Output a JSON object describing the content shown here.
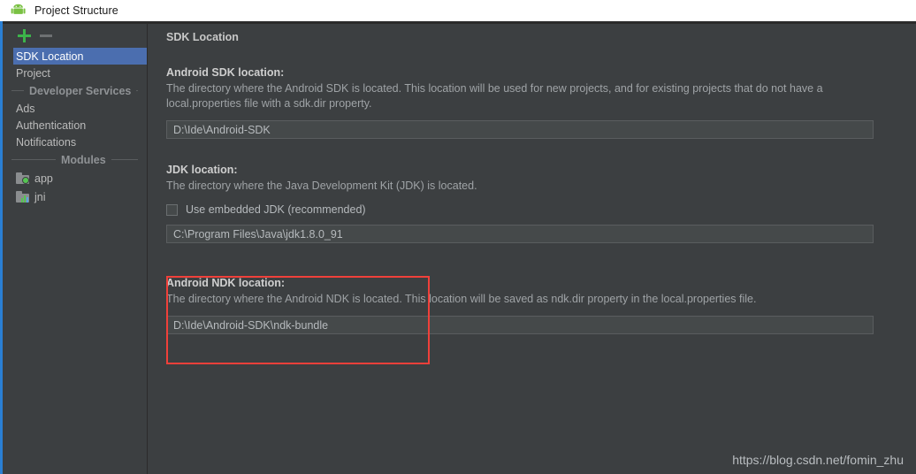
{
  "window": {
    "title": "Project Structure",
    "icon": "android-robot-icon"
  },
  "sidebar": {
    "toolbar": {
      "add_label": "+",
      "add_icon": "plus-icon",
      "remove_label": "−",
      "remove_icon": "minus-icon"
    },
    "items": [
      {
        "label": "SDK Location",
        "selected": true
      },
      {
        "label": "Project",
        "selected": false
      }
    ],
    "separators": {
      "developer_services": "Developer Services",
      "modules": "Modules"
    },
    "services": [
      {
        "label": "Ads"
      },
      {
        "label": "Authentication"
      },
      {
        "label": "Notifications"
      }
    ],
    "modules": [
      {
        "label": "app",
        "icon": "folder-green-dot-icon"
      },
      {
        "label": "jni",
        "icon": "folder-library-icon"
      }
    ]
  },
  "main": {
    "panel_title": "SDK Location",
    "sections": [
      {
        "heading": "Android SDK location:",
        "description": "The directory where the Android SDK is located. This location will be used for new projects, and for existing projects that do not have a local.properties file with a sdk.dir property.",
        "field_value": "D:\\Ide\\Android-SDK",
        "browse_label": "...",
        "browse_icon": "ellipsis-icon"
      },
      {
        "heading": "JDK location:",
        "description": "The directory where the Java Development Kit (JDK) is located.",
        "checkbox_label": "Use embedded JDK (recommended)",
        "checkbox_checked": false,
        "field_value": "C:\\Program Files\\Java\\jdk1.8.0_91",
        "browse_label": "...",
        "browse_icon": "ellipsis-icon"
      },
      {
        "heading": "Android NDK location:",
        "description": "The directory where the Android NDK is located. This location will be saved as ndk.dir property in the local.properties file.",
        "field_value": "D:\\Ide\\Android-SDK\\ndk-bundle",
        "browse_label": "...",
        "browse_icon": "ellipsis-icon"
      }
    ]
  },
  "annotation": {
    "color": "#f0403a",
    "target": "Android NDK location section"
  },
  "watermark": {
    "text": "https://blog.csdn.net/fomin_zhu"
  },
  "colors": {
    "background": "#3c3f41",
    "selection": "#4b6eaf",
    "accent_strip": "#2a7fd4",
    "add_icon": "#3cb44a",
    "annotation": "#f0403a"
  }
}
